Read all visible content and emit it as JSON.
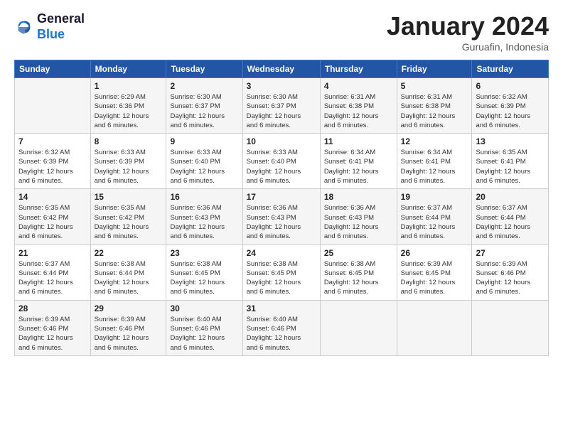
{
  "logo": {
    "line1": "General",
    "line2": "Blue"
  },
  "header": {
    "month": "January 2024",
    "location": "Guruafin, Indonesia"
  },
  "days_of_week": [
    "Sunday",
    "Monday",
    "Tuesday",
    "Wednesday",
    "Thursday",
    "Friday",
    "Saturday"
  ],
  "weeks": [
    [
      {
        "day": "",
        "info": ""
      },
      {
        "day": "1",
        "info": "Sunrise: 6:29 AM\nSunset: 6:36 PM\nDaylight: 12 hours\nand 6 minutes."
      },
      {
        "day": "2",
        "info": "Sunrise: 6:30 AM\nSunset: 6:37 PM\nDaylight: 12 hours\nand 6 minutes."
      },
      {
        "day": "3",
        "info": "Sunrise: 6:30 AM\nSunset: 6:37 PM\nDaylight: 12 hours\nand 6 minutes."
      },
      {
        "day": "4",
        "info": "Sunrise: 6:31 AM\nSunset: 6:38 PM\nDaylight: 12 hours\nand 6 minutes."
      },
      {
        "day": "5",
        "info": "Sunrise: 6:31 AM\nSunset: 6:38 PM\nDaylight: 12 hours\nand 6 minutes."
      },
      {
        "day": "6",
        "info": "Sunrise: 6:32 AM\nSunset: 6:39 PM\nDaylight: 12 hours\nand 6 minutes."
      }
    ],
    [
      {
        "day": "7",
        "info": "Sunrise: 6:32 AM\nSunset: 6:39 PM\nDaylight: 12 hours\nand 6 minutes."
      },
      {
        "day": "8",
        "info": "Sunrise: 6:33 AM\nSunset: 6:39 PM\nDaylight: 12 hours\nand 6 minutes."
      },
      {
        "day": "9",
        "info": "Sunrise: 6:33 AM\nSunset: 6:40 PM\nDaylight: 12 hours\nand 6 minutes."
      },
      {
        "day": "10",
        "info": "Sunrise: 6:33 AM\nSunset: 6:40 PM\nDaylight: 12 hours\nand 6 minutes."
      },
      {
        "day": "11",
        "info": "Sunrise: 6:34 AM\nSunset: 6:41 PM\nDaylight: 12 hours\nand 6 minutes."
      },
      {
        "day": "12",
        "info": "Sunrise: 6:34 AM\nSunset: 6:41 PM\nDaylight: 12 hours\nand 6 minutes."
      },
      {
        "day": "13",
        "info": "Sunrise: 6:35 AM\nSunset: 6:41 PM\nDaylight: 12 hours\nand 6 minutes."
      }
    ],
    [
      {
        "day": "14",
        "info": "Sunrise: 6:35 AM\nSunset: 6:42 PM\nDaylight: 12 hours\nand 6 minutes."
      },
      {
        "day": "15",
        "info": "Sunrise: 6:35 AM\nSunset: 6:42 PM\nDaylight: 12 hours\nand 6 minutes."
      },
      {
        "day": "16",
        "info": "Sunrise: 6:36 AM\nSunset: 6:43 PM\nDaylight: 12 hours\nand 6 minutes."
      },
      {
        "day": "17",
        "info": "Sunrise: 6:36 AM\nSunset: 6:43 PM\nDaylight: 12 hours\nand 6 minutes."
      },
      {
        "day": "18",
        "info": "Sunrise: 6:36 AM\nSunset: 6:43 PM\nDaylight: 12 hours\nand 6 minutes."
      },
      {
        "day": "19",
        "info": "Sunrise: 6:37 AM\nSunset: 6:44 PM\nDaylight: 12 hours\nand 6 minutes."
      },
      {
        "day": "20",
        "info": "Sunrise: 6:37 AM\nSunset: 6:44 PM\nDaylight: 12 hours\nand 6 minutes."
      }
    ],
    [
      {
        "day": "21",
        "info": "Sunrise: 6:37 AM\nSunset: 6:44 PM\nDaylight: 12 hours\nand 6 minutes."
      },
      {
        "day": "22",
        "info": "Sunrise: 6:38 AM\nSunset: 6:44 PM\nDaylight: 12 hours\nand 6 minutes."
      },
      {
        "day": "23",
        "info": "Sunrise: 6:38 AM\nSunset: 6:45 PM\nDaylight: 12 hours\nand 6 minutes."
      },
      {
        "day": "24",
        "info": "Sunrise: 6:38 AM\nSunset: 6:45 PM\nDaylight: 12 hours\nand 6 minutes."
      },
      {
        "day": "25",
        "info": "Sunrise: 6:38 AM\nSunset: 6:45 PM\nDaylight: 12 hours\nand 6 minutes."
      },
      {
        "day": "26",
        "info": "Sunrise: 6:39 AM\nSunset: 6:45 PM\nDaylight: 12 hours\nand 6 minutes."
      },
      {
        "day": "27",
        "info": "Sunrise: 6:39 AM\nSunset: 6:46 PM\nDaylight: 12 hours\nand 6 minutes."
      }
    ],
    [
      {
        "day": "28",
        "info": "Sunrise: 6:39 AM\nSunset: 6:46 PM\nDaylight: 12 hours\nand 6 minutes."
      },
      {
        "day": "29",
        "info": "Sunrise: 6:39 AM\nSunset: 6:46 PM\nDaylight: 12 hours\nand 6 minutes."
      },
      {
        "day": "30",
        "info": "Sunrise: 6:40 AM\nSunset: 6:46 PM\nDaylight: 12 hours\nand 6 minutes."
      },
      {
        "day": "31",
        "info": "Sunrise: 6:40 AM\nSunset: 6:46 PM\nDaylight: 12 hours\nand 6 minutes."
      },
      {
        "day": "",
        "info": ""
      },
      {
        "day": "",
        "info": ""
      },
      {
        "day": "",
        "info": ""
      }
    ]
  ]
}
